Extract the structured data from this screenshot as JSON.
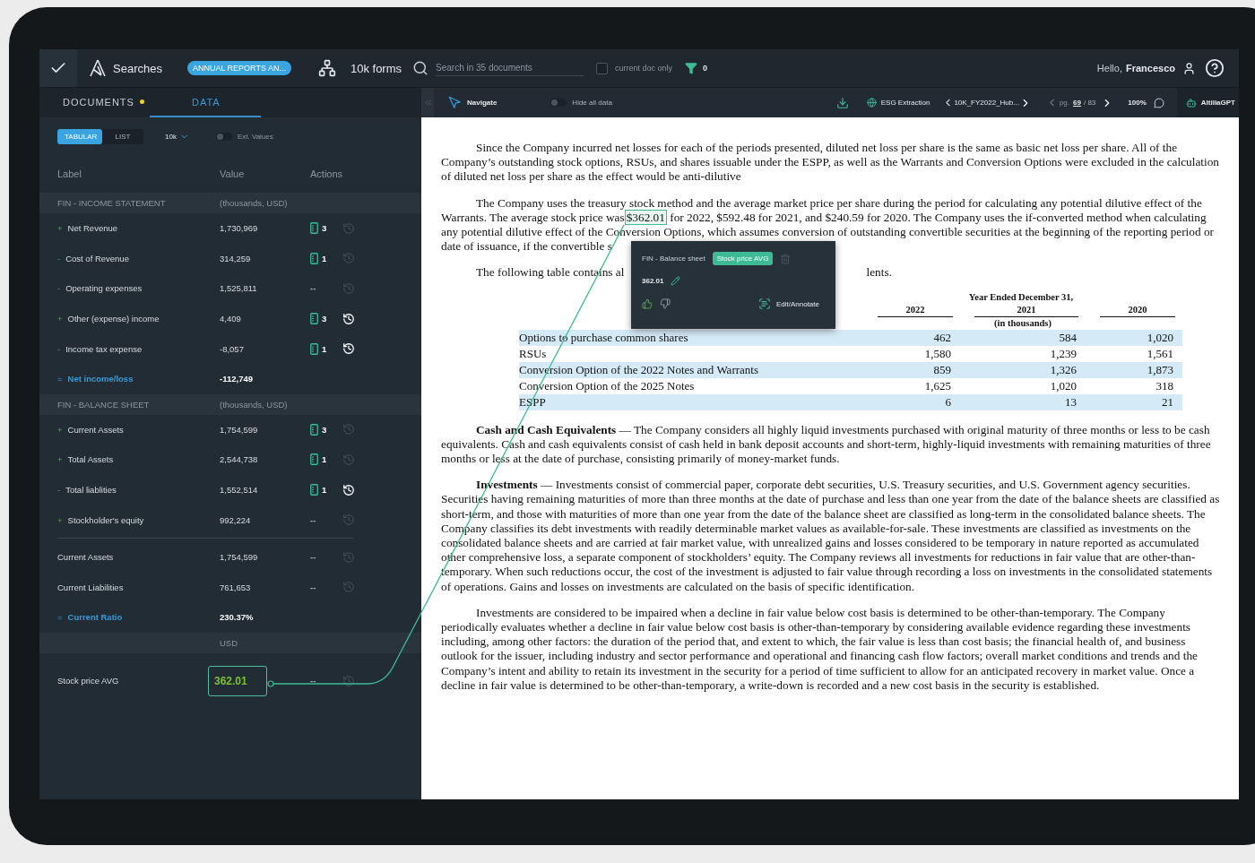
{
  "topbar": {
    "app_label": "Searches",
    "tag": "ANNUAL REPORTS AN...",
    "forms": "10k forms",
    "search_placeholder": "Search in 35 documents",
    "current_doc_only": {
      "label": "current doc only",
      "checked": false
    },
    "filter_count": "0",
    "greeting": "Hello,",
    "user": "Francesco"
  },
  "panel_tabs": [
    {
      "label": "DOCUMENTS",
      "dot": true,
      "selected": false
    },
    {
      "label": "DATA",
      "dot": false,
      "selected": true
    }
  ],
  "view_modes": [
    {
      "label": "TABULAR",
      "selected": true
    },
    {
      "label": "LIST",
      "selected": false
    }
  ],
  "form_select": "10k",
  "ext_values": {
    "label": "Ext. Values",
    "on": false
  },
  "columns": [
    "Label",
    "Value",
    "Actions"
  ],
  "sections": [
    {
      "title": "FIN - INCOME STATEMENT",
      "unit": "(thousands, USD)",
      "rows": [
        {
          "kind": "item",
          "sign": "+",
          "label": "Net Revenue",
          "value": "1,730,969",
          "doc_icon": true,
          "sources": "3",
          "history_active": false
        },
        {
          "kind": "item",
          "sign": "-",
          "label": "Cost of Revenue",
          "value": "314,259",
          "doc_icon": true,
          "sources": "1",
          "history_active": false
        },
        {
          "kind": "item",
          "sign": "-",
          "label": "Operating expenses",
          "value": "1,525,811",
          "doc_icon": false,
          "sources": "--",
          "history_active": false
        },
        {
          "kind": "item",
          "sign": "+",
          "label": "Other (expense) income",
          "value": "4,409",
          "doc_icon": true,
          "sources": "3",
          "history_active": true
        },
        {
          "kind": "item",
          "sign": "-",
          "label": "Income tax expense",
          "value": "-8,057",
          "doc_icon": true,
          "sources": "1",
          "history_active": true
        },
        {
          "kind": "total",
          "sign": "=",
          "label": "Net income/loss",
          "value": "-112,749"
        }
      ]
    },
    {
      "title": "FIN - BALANCE SHEET",
      "unit": "(thousands, USD)",
      "rows": [
        {
          "kind": "item",
          "sign": "+",
          "label": "Current Assets",
          "value": "1,754,599",
          "doc_icon": true,
          "sources": "3",
          "history_active": false
        },
        {
          "kind": "item",
          "sign": "+",
          "label": "Total Assets",
          "value": "2,544,738",
          "doc_icon": true,
          "sources": "1",
          "history_active": false
        },
        {
          "kind": "item",
          "sign": "-",
          "label": "Total liablities",
          "value": "1,552,514",
          "doc_icon": true,
          "sources": "1",
          "history_active": true
        },
        {
          "kind": "item",
          "sign": "+",
          "label": "Stockholder's equity",
          "value": "992,224",
          "doc_icon": false,
          "sources": "--",
          "history_active": false
        },
        {
          "kind": "plain",
          "label": "Current Assets",
          "value": "1,754,599",
          "doc_icon": false,
          "sources": "--",
          "history_active": false
        },
        {
          "kind": "plain",
          "label": "Current Liabilities",
          "value": "761,653",
          "doc_icon": false,
          "sources": "--",
          "history_active": false
        },
        {
          "kind": "total",
          "sign": "=",
          "label": "Current Ratio",
          "value": "230.37%"
        }
      ]
    },
    {
      "unit": "USD",
      "rows": [
        {
          "kind": "linked",
          "label": "Stock price AVG",
          "value": "362.01",
          "doc_icon": false,
          "sources": "--",
          "history_active": false
        }
      ]
    }
  ],
  "doc_toolbar": {
    "navigate": "Navigate",
    "hide_all": {
      "label": "Hide all data",
      "on": false
    },
    "esg": "ESG Extraction",
    "doc_name": "10K_FY2022_Hub...",
    "page_prefix": "pg.",
    "page": "69",
    "page_total": "/ 83",
    "zoom": "100%",
    "assistant": "AltiliaGPT"
  },
  "document": {
    "p1": "Since the Company incurred net losses for each of the periods presented, diluted net loss per share is the same as basic net loss per share. All of the Company’s outstanding stock options, RSUs, and shares issuable under the ESPP, as well as the Warrants and Conversion Options were excluded in the calculation of diluted net loss per share as the effect would be anti-dilutive",
    "p2_before": "The Company uses the treasury stock method and the average market price per share during the period for calculating any potential dilutive effect of the Warrants. The average stock price was",
    "p2_highlight": "$362.01",
    "p2_after": "for 2022, $592.48 for 2021, and $240.59 for 2020. The Company uses the if-converted method when calculating any potential dilutive effect of the Conversion Options, which assumes conversion of outstanding convertible securities at the beginning of the reporting period or date of issuance, if the convertible s",
    "p3_start": "The following table contains al",
    "p3_end": "lents.",
    "table": {
      "period": "Year Ended December 31,",
      "years": [
        "2022",
        "2021",
        "2020"
      ],
      "unit": "(in thousands)",
      "rows": [
        {
          "label": "Options to purchase common shares",
          "values": [
            "462",
            "584",
            "1,020"
          ]
        },
        {
          "label": "RSUs",
          "values": [
            "1,580",
            "1,239",
            "1,561"
          ]
        },
        {
          "label": "Conversion Option of the 2022 Notes and Warrants",
          "values": [
            "859",
            "1,326",
            "1,873"
          ]
        },
        {
          "label": "Conversion Option of the 2025 Notes",
          "values": [
            "1,625",
            "1,020",
            "318"
          ]
        },
        {
          "label": "ESPP",
          "values": [
            "6",
            "13",
            "21"
          ]
        }
      ]
    },
    "paragraphs": [
      "**Cash and Cash Equivalents** — The Company considers all highly liquid investments purchased with original maturity of three months or less to be cash equivalents. Cash and cash equivalents consist of cash held in bank deposit accounts and short-term, highly-liquid investments with remaining maturities of three months or less at the date of purchase, consisting primarily of money-market funds.",
      "**Investments** — Investments consist of commercial paper, corporate debt securities, U.S. Treasury securities, and U.S. Government agency securities. Securities having remaining maturities of more than three months at the date of purchase and less than one year from the date of the balance sheets are classified as short-term, and those with maturities of more than one year from the date of the balance sheet are classified as long-term in the consolidated balance sheets. The Company classifies its debt investments with readily determinable market values as available-for-sale. These investments are classified as investments on the consolidated balance sheets and are carried at fair market value, with unrealized gains and losses considered to be temporary in nature reported as accumulated other comprehensive loss, a separate component of stockholders’ equity. The Company reviews all investments for reductions in fair value that are other-than-temporary. When such reductions occur, the cost of the investment is adjusted to fair value through recording a loss on investments in the consolidated statements of operations. Gains and losses on investments are calculated on the basis of specific identification.",
      "Investments are considered to be impaired when a decline in fair value below cost basis is determined to be other-than-temporary. The Company periodically evaluates whether a decline in fair value below cost basis is other-than-temporary by considering available evidence regarding these investments including, among other factors: the duration of the period that, and extent to which, the fair value is less than cost basis; the financial health of, and business outlook for the issuer, including industry and sector performance and operational and financing cash flow factors; overall market conditions and trends and the Company’s intent and ability to retain its investment in the security for a period of time sufficient to allow for an anticipated recovery in market value. Once a decline in fair value is determined to be other-than-temporary, a write-down is recorded and a new cost basis in the security is established."
    ]
  },
  "popup": {
    "category": "FIN - Balance sheet",
    "tag": "Stock price AVG",
    "value": "362.01",
    "action": "Edit/Annotate"
  }
}
